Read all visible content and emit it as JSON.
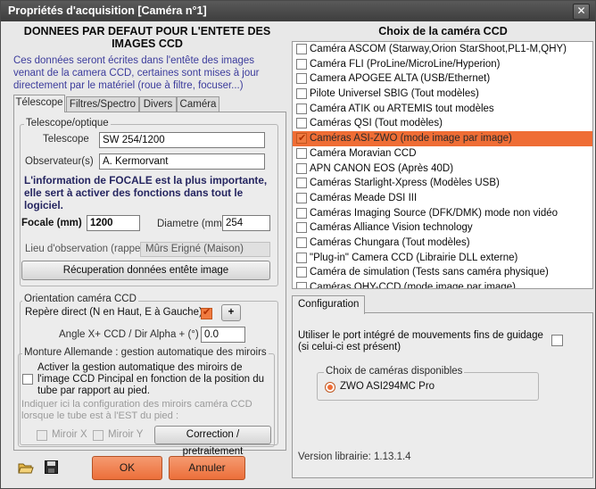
{
  "window": {
    "title": "Propriétés d'acquisition [Caméra n°1]",
    "close": "✕"
  },
  "left": {
    "header": "DONNEES PAR DEFAUT POUR L'ENTETE DES IMAGES CCD",
    "intro": "Ces données seront écrites dans l'entête des images  venant de la camera CCD, certaines sont mises à jour directement par le matériel (roue à filtre, focuser...)",
    "tabs": [
      "Télescope",
      "Filtres/Spectro",
      "Divers",
      "Caméra"
    ],
    "telescope_group": "Telescope/optique",
    "telescope_label": "Telescope",
    "telescope_value": "SW 254/1200",
    "observer_label": "Observateur(s)",
    "observer_value": "A. Kermorvant",
    "focal_info": "L'information de FOCALE est la plus importante, elle sert à activer des fonctions dans tout le logiciel.",
    "focal_label": "Focale (mm)",
    "focal_value": "1200",
    "diameter_label": "Diametre (mm)",
    "diameter_value": "254",
    "location_label": "Lieu d'observation (rappel)",
    "location_value": "Mûrs Erigné (Maison)",
    "recover_button": "Récuperation données entête image",
    "orientation_group": "Orientation caméra CCD",
    "direct_label": "Repère direct (N en Haut, E à Gauche)",
    "plus_button": "+",
    "angle_label": "Angle X+ CCD / Dir Alpha + (°) :",
    "angle_value": "0.0",
    "mount_group": "Monture Allemande : gestion automatique des miroirs",
    "mount_check_label": "Activer la gestion automatique des miroirs de l'image CCD Pincipal en fonction de la position du tube par rapport au pied.",
    "mount_info": "Indiquer ici la configuration des miroirs caméra CCD lorsque le tube est à l'EST du pied :",
    "mirror_x": "Miroir X",
    "mirror_y": "Miroir Y",
    "correction_button": "Correction / pretraitement"
  },
  "right": {
    "header": "Choix de la caméra CCD",
    "cameras": [
      {
        "label": "Caméra ASCOM (Starway,Orion StarShoot,PL1-M,QHY)",
        "checked": false
      },
      {
        "label": "Caméra FLI (ProLine/MicroLine/Hyperion)",
        "checked": false
      },
      {
        "label": "Camera APOGEE ALTA (USB/Ethernet)",
        "checked": false
      },
      {
        "label": "Pilote Universel SBIG (Tout modèles)",
        "checked": false
      },
      {
        "label": "Caméra ATIK ou ARTEMIS tout modèles",
        "checked": false
      },
      {
        "label": "Caméras QSI (Tout modèles)",
        "checked": false
      },
      {
        "label": "Caméras ASI-ZWO (mode image par image)",
        "checked": true
      },
      {
        "label": "Caméra Moravian CCD",
        "checked": false
      },
      {
        "label": "APN CANON EOS (Après 40D)",
        "checked": false
      },
      {
        "label": "Caméras Starlight-Xpress (Modèles USB)",
        "checked": false
      },
      {
        "label": "Caméras Meade DSI III",
        "checked": false
      },
      {
        "label": "Caméras Imaging Source (DFK/DMK) mode non vidéo",
        "checked": false
      },
      {
        "label": "Caméras Alliance Vision technology",
        "checked": false
      },
      {
        "label": "Caméras Chungara (Tout modèles)",
        "checked": false
      },
      {
        "label": "\"Plug-in\" Camera CCD (Librairie DLL externe)",
        "checked": false
      },
      {
        "label": "Caméra de simulation (Tests sans caméra physique)",
        "checked": false
      },
      {
        "label": "Caméras QHY-CCD (mode image par image)",
        "checked": false
      }
    ],
    "config_tab": "Configuration",
    "guide_port_label": "Utiliser le port intégré de mouvements fins de guidage (si celui-ci est présent)",
    "available_group": "Choix de caméras disponibles",
    "available_camera": "ZWO ASI294MC Pro",
    "library_version": "Version librairie: 1.13.1.4"
  },
  "footer": {
    "ok": "OK",
    "cancel": "Annuler"
  },
  "colors": {
    "accent": "#ef6d35",
    "title_bg": "#3d3d3d"
  }
}
